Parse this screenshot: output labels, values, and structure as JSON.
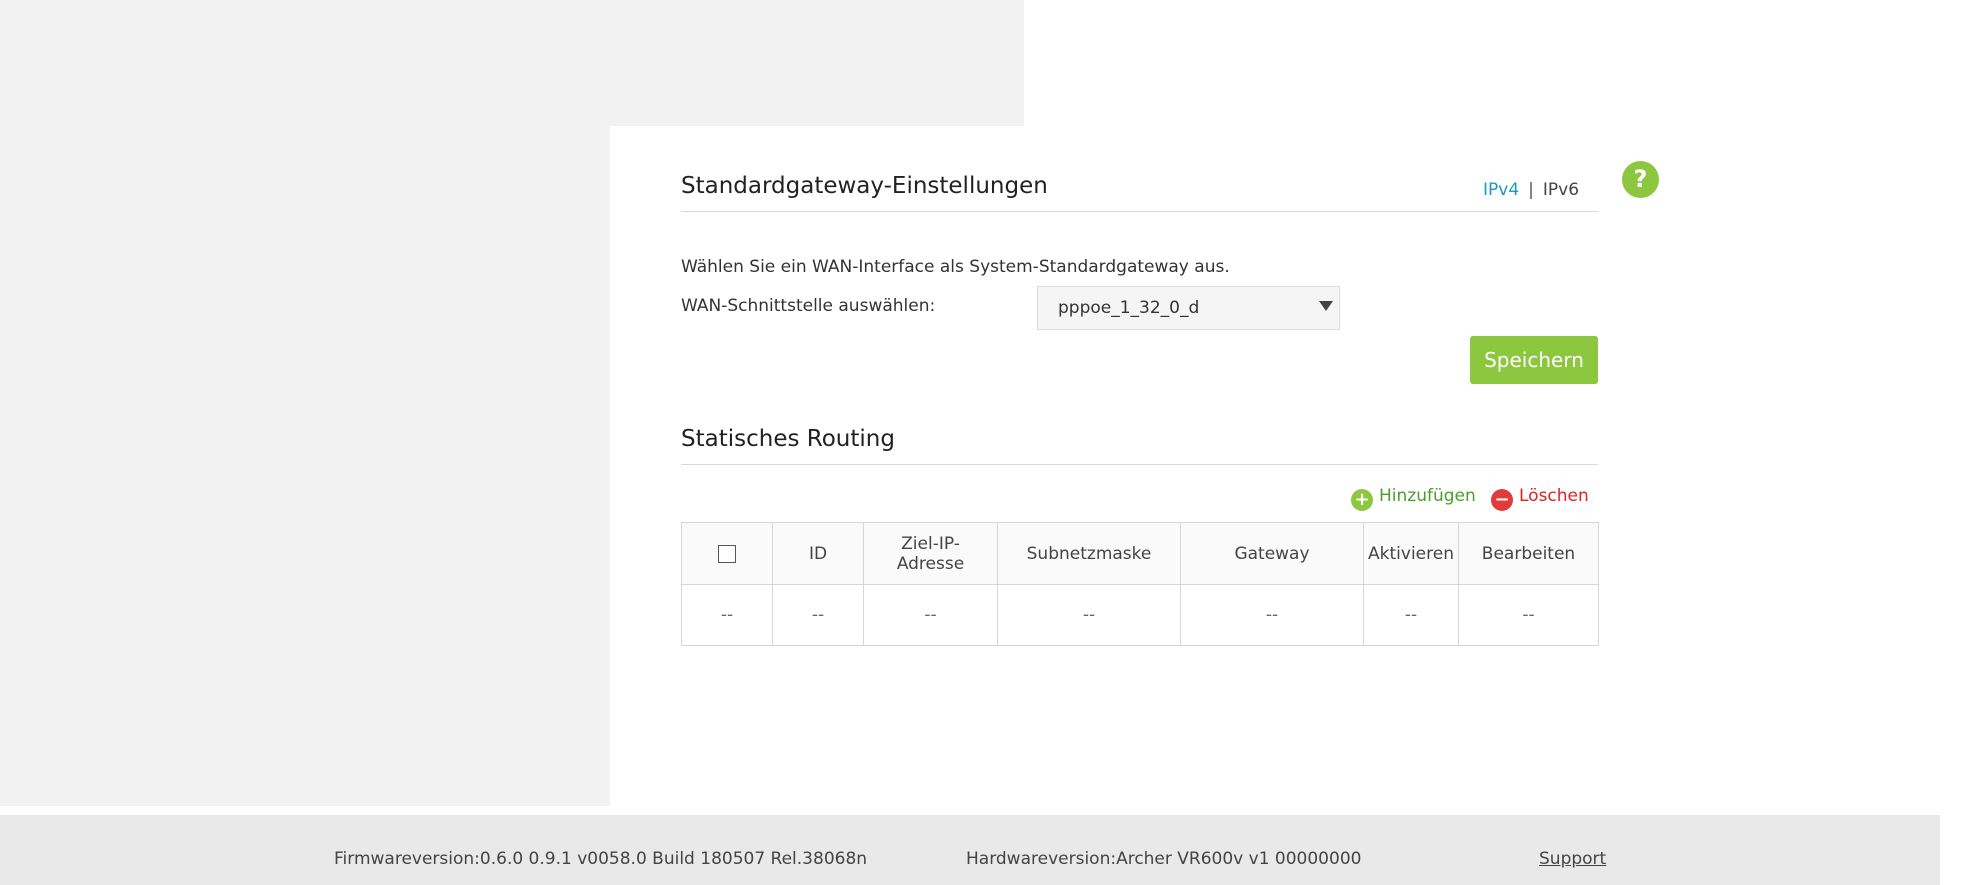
{
  "gateway": {
    "title": "Standardgateway-Einstellungen",
    "ip_tabs": [
      "IPv4",
      "IPv6"
    ],
    "separator": "|",
    "description": "Wählen Sie ein WAN-Interface als System-Standardgateway aus.",
    "wan_label": "WAN-Schnittstelle auswählen:",
    "wan_value": "pppoe_1_32_0_d",
    "save_label": "Speichern"
  },
  "help": {
    "label": "?"
  },
  "routing": {
    "title": "Statisches Routing",
    "add_label": "Hinzufügen",
    "delete_label": "Löschen",
    "columns": [
      "ID",
      "Ziel-IP-\nAdresse",
      "Subnetzmaske",
      "Gateway",
      "Aktivieren",
      "Bearbeiten"
    ],
    "empty_row": [
      "--",
      "--",
      "--",
      "--",
      "--",
      "--",
      "--"
    ]
  },
  "footer": {
    "firmware": "Firmwareversion:0.6.0 0.9.1 v0058.0 Build 180507 Rel.38068n",
    "hardware": "Hardwareversion:Archer VR600v v1 00000000",
    "support": "Support"
  },
  "colors": {
    "accent_green": "#8dc63f",
    "link_blue": "#1a9bc0",
    "delete_red": "#e23b3b",
    "background_grey": "#f2f2f2"
  },
  "icons": {
    "help": "question-icon",
    "add": "plus-circle-icon",
    "delete": "minus-circle-icon",
    "dropdown": "caret-down-icon"
  }
}
